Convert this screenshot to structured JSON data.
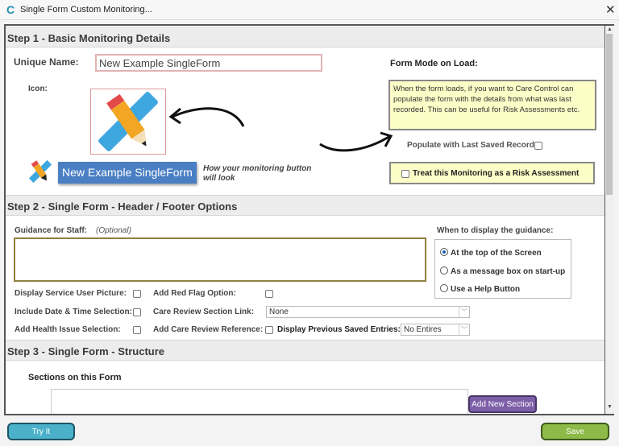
{
  "window": {
    "title": "Single Form Custom Monitoring...",
    "close_icon": "close-icon",
    "app_icon": "care-control-logo"
  },
  "step1": {
    "header": "Step 1 - Basic Monitoring Details",
    "unique_name_label": "Unique Name:",
    "unique_name_value": "New Example SingleForm",
    "icon_label": "Icon:",
    "preview_button_label": "New Example SingleForm",
    "preview_caption": "How your monitoring button will look",
    "form_mode_label": "Form Mode on Load:",
    "form_mode_info": "When the form loads, if you want to Care Control can populate the form with the details from what was last recorded.  This can be useful for Risk Assessments etc.",
    "populate_label": "Populate with Last Saved Record:",
    "populate_checked": false,
    "risk_label": "Treat this Monitoring as a Risk Assessment",
    "risk_checked": false
  },
  "step2": {
    "header": "Step 2 - Single Form - Header / Footer Options",
    "guidance_label": "Guidance for Staff:",
    "guidance_optional": "(Optional)",
    "guidance_value": "",
    "when_label": "When to display the guidance:",
    "radio_options": [
      "At the top of the Screen",
      "As a message box on start-up",
      "Use a Help Button"
    ],
    "radio_selected": 0,
    "display_picture_label": "Display Service User Picture:",
    "red_flag_label": "Add Red Flag Option:",
    "date_time_label": "Include Date & Time Selection:",
    "care_review_link_label": "Care Review Section Link:",
    "care_review_link_value": "None",
    "health_issue_label": "Add Health Issue Selection:",
    "care_review_ref_label": "Add Care Review Reference:",
    "display_prev_label": "Display Previous Saved Entries:",
    "display_prev_value": "No Entires"
  },
  "step3": {
    "header": "Step 3 - Single Form - Structure",
    "sections_label": "Sections on this Form",
    "add_section_label": "Add New Section"
  },
  "footer": {
    "try_label": "Try It",
    "save_label": "Save"
  },
  "colors": {
    "try": "#4bb0c9",
    "save": "#8dba48",
    "add_section": "#7d5ea8",
    "preview_button": "#4a7fc4",
    "info_yellow": "#fdfdc8"
  }
}
